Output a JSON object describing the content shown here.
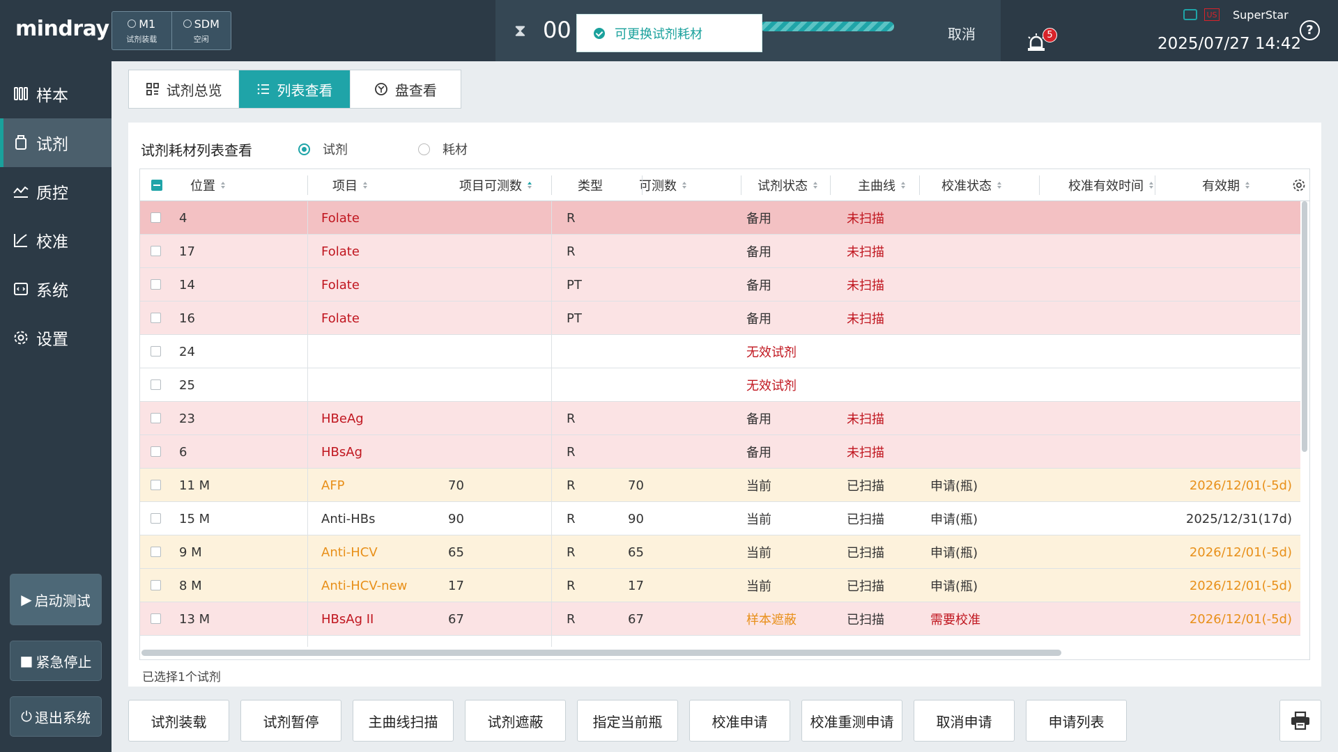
{
  "header": {
    "logo": "mindray",
    "modules": [
      {
        "name": "M1",
        "status": "试剂装载"
      },
      {
        "name": "SDM",
        "status": "空闲"
      }
    ],
    "timer": "00",
    "cancel_label": "取消",
    "toast": "可更换试剂耗材",
    "alarm_count": "5",
    "lang_badge": "US",
    "user": "SuperStar",
    "datetime": "2025/07/27 14:42",
    "help": "?"
  },
  "sidebar": {
    "items": [
      {
        "label": "样本",
        "icon": "sample-icon"
      },
      {
        "label": "试剂",
        "icon": "reagent-icon"
      },
      {
        "label": "质控",
        "icon": "qc-icon"
      },
      {
        "label": "校准",
        "icon": "calibration-icon"
      },
      {
        "label": "系统",
        "icon": "system-icon"
      },
      {
        "label": "设置",
        "icon": "settings-icon"
      }
    ],
    "start_label": "启动测试",
    "stop_label": "紧急停止",
    "exit_label": "退出系统"
  },
  "tabs": [
    {
      "label": "试剂总览"
    },
    {
      "label": "列表查看"
    },
    {
      "label": "盘查看"
    }
  ],
  "panel": {
    "title": "试剂耗材列表查看",
    "radio_reagent": "试剂",
    "radio_consumable": "耗材"
  },
  "table": {
    "columns": [
      "位置",
      "项目",
      "项目可测数",
      "类型",
      "可测数",
      "试剂状态",
      "主曲线",
      "校准状态",
      "校准有效时间",
      "有效期"
    ],
    "rows": [
      {
        "pos": "4",
        "item": "Folate",
        "item_tests": "",
        "type": "R",
        "tests": "",
        "status": "备用",
        "curve": "未扫描",
        "cal": "",
        "cal_time": "",
        "expiry": ""
      },
      {
        "pos": "17",
        "item": "Folate",
        "item_tests": "",
        "type": "R",
        "tests": "",
        "status": "备用",
        "curve": "未扫描",
        "cal": "",
        "cal_time": "",
        "expiry": ""
      },
      {
        "pos": "14",
        "item": "Folate",
        "item_tests": "",
        "type": "PT",
        "tests": "",
        "status": "备用",
        "curve": "未扫描",
        "cal": "",
        "cal_time": "",
        "expiry": ""
      },
      {
        "pos": "16",
        "item": "Folate",
        "item_tests": "",
        "type": "PT",
        "tests": "",
        "status": "备用",
        "curve": "未扫描",
        "cal": "",
        "cal_time": "",
        "expiry": ""
      },
      {
        "pos": "24",
        "item": "",
        "item_tests": "",
        "type": "",
        "tests": "",
        "status": "无效试剂",
        "curve": "",
        "cal": "",
        "cal_time": "",
        "expiry": ""
      },
      {
        "pos": "25",
        "item": "",
        "item_tests": "",
        "type": "",
        "tests": "",
        "status": "无效试剂",
        "curve": "",
        "cal": "",
        "cal_time": "",
        "expiry": ""
      },
      {
        "pos": "23",
        "item": "HBeAg",
        "item_tests": "",
        "type": "R",
        "tests": "",
        "status": "备用",
        "curve": "未扫描",
        "cal": "",
        "cal_time": "",
        "expiry": ""
      },
      {
        "pos": "6",
        "item": "HBsAg",
        "item_tests": "",
        "type": "R",
        "tests": "",
        "status": "备用",
        "curve": "未扫描",
        "cal": "",
        "cal_time": "",
        "expiry": ""
      },
      {
        "pos": "11 M",
        "item": "AFP",
        "item_tests": "70",
        "type": "R",
        "tests": "70",
        "status": "当前",
        "curve": "已扫描",
        "cal": "申请(瓶)",
        "cal_time": "",
        "expiry": "2026/12/01(-5d)"
      },
      {
        "pos": "15 M",
        "item": "Anti-HBs",
        "item_tests": "90",
        "type": "R",
        "tests": "90",
        "status": "当前",
        "curve": "已扫描",
        "cal": "申请(瓶)",
        "cal_time": "",
        "expiry": "2025/12/31(17d)"
      },
      {
        "pos": "9 M",
        "item": "Anti-HCV",
        "item_tests": "65",
        "type": "R",
        "tests": "65",
        "status": "当前",
        "curve": "已扫描",
        "cal": "申请(瓶)",
        "cal_time": "",
        "expiry": "2026/12/01(-5d)"
      },
      {
        "pos": "8 M",
        "item": "Anti-HCV-new",
        "item_tests": "17",
        "type": "R",
        "tests": "17",
        "status": "当前",
        "curve": "已扫描",
        "cal": "申请(瓶)",
        "cal_time": "",
        "expiry": "2026/12/01(-5d)"
      },
      {
        "pos": "13 M",
        "item": "HBsAg II",
        "item_tests": "67",
        "type": "R",
        "tests": "67",
        "status": "样本遮蔽",
        "curve": "已扫描",
        "cal": "需要校准",
        "cal_time": "",
        "expiry": "2026/12/01(-5d)"
      }
    ]
  },
  "selected_info": "已选择1个试剂",
  "actions": [
    "试剂装载",
    "试剂暂停",
    "主曲线扫描",
    "试剂遮蔽",
    "指定当前瓶",
    "校准申请",
    "校准重测申请",
    "取消申请",
    "申请列表"
  ],
  "colors": {
    "accent": "#1fa4a8",
    "sidebar_bg": "#2c3a46",
    "row_pink_selected": "#f3c1c3",
    "row_pink": "#fbe3e4",
    "row_yellow": "#fdf2dc",
    "text_red": "#c0161f",
    "text_orange": "#e8901a"
  }
}
